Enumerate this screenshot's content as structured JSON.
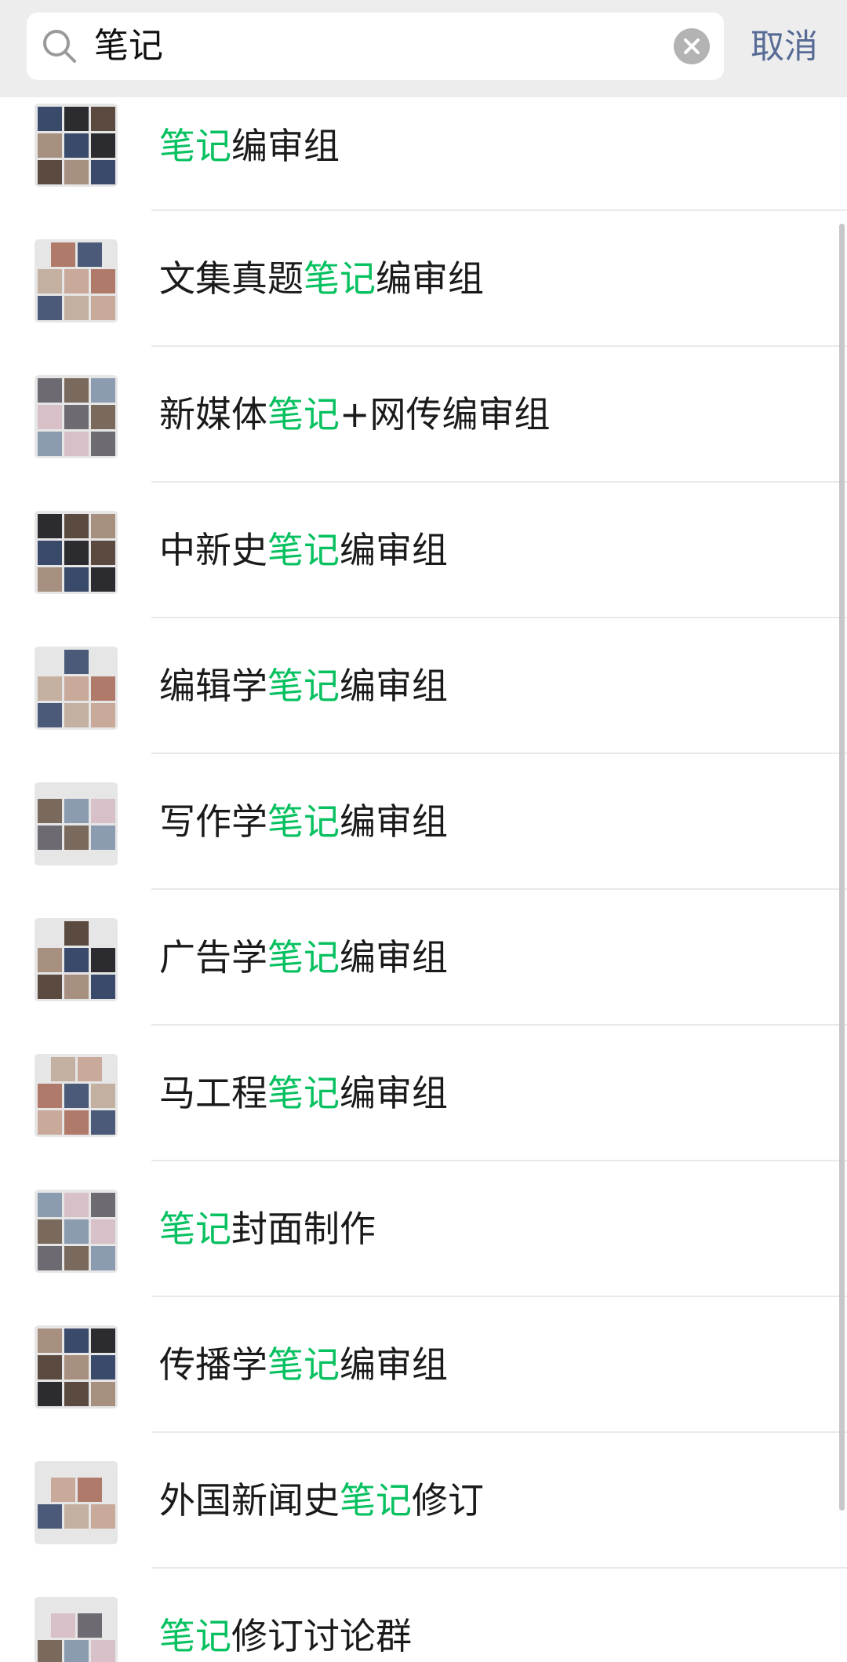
{
  "search": {
    "query": "笔记",
    "cancel_label": "取消"
  },
  "results": [
    {
      "parts": [
        {
          "t": "笔记",
          "hl": true
        },
        {
          "t": "编审组",
          "hl": false
        }
      ]
    },
    {
      "parts": [
        {
          "t": "文集真题",
          "hl": false
        },
        {
          "t": "笔记",
          "hl": true
        },
        {
          "t": "编审组",
          "hl": false
        }
      ]
    },
    {
      "parts": [
        {
          "t": "新媒体",
          "hl": false
        },
        {
          "t": "笔记",
          "hl": true
        },
        {
          "t": "+网传编审组",
          "hl": false
        }
      ]
    },
    {
      "parts": [
        {
          "t": "中新史",
          "hl": false
        },
        {
          "t": "笔记",
          "hl": true
        },
        {
          "t": "编审组",
          "hl": false
        }
      ]
    },
    {
      "parts": [
        {
          "t": "编辑学",
          "hl": false
        },
        {
          "t": "笔记",
          "hl": true
        },
        {
          "t": "编审组",
          "hl": false
        }
      ]
    },
    {
      "parts": [
        {
          "t": "写作学",
          "hl": false
        },
        {
          "t": "笔记",
          "hl": true
        },
        {
          "t": "编审组",
          "hl": false
        }
      ]
    },
    {
      "parts": [
        {
          "t": "广告学",
          "hl": false
        },
        {
          "t": "笔记",
          "hl": true
        },
        {
          "t": "编审组",
          "hl": false
        }
      ]
    },
    {
      "parts": [
        {
          "t": "马工程",
          "hl": false
        },
        {
          "t": "笔记",
          "hl": true
        },
        {
          "t": "编审组",
          "hl": false
        }
      ]
    },
    {
      "parts": [
        {
          "t": "笔记",
          "hl": true
        },
        {
          "t": "封面制作",
          "hl": false
        }
      ]
    },
    {
      "parts": [
        {
          "t": "传播学",
          "hl": false
        },
        {
          "t": "笔记",
          "hl": true
        },
        {
          "t": "编审组",
          "hl": false
        }
      ]
    },
    {
      "parts": [
        {
          "t": "外国新闻史",
          "hl": false
        },
        {
          "t": "笔记",
          "hl": true
        },
        {
          "t": "修订",
          "hl": false
        }
      ]
    },
    {
      "parts": [
        {
          "t": "笔记",
          "hl": true
        },
        {
          "t": "修订讨论群",
          "hl": false
        }
      ]
    }
  ],
  "group_avatar_member_counts": [
    9,
    8,
    9,
    9,
    7,
    6,
    7,
    8,
    9,
    9,
    5,
    5
  ],
  "colors": {
    "highlight": "#07c160",
    "cancel": "#576b95",
    "topbar_bg": "#ededed"
  },
  "icons": {
    "search": "search-icon",
    "clear": "clear-icon"
  }
}
